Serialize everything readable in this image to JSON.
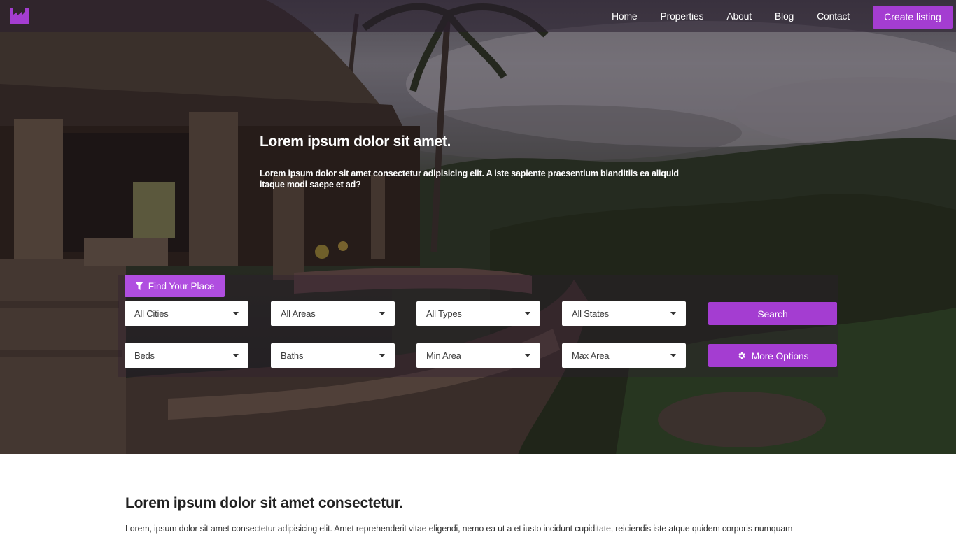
{
  "brand": {
    "accent": "#a43dd1",
    "logo_icon": "factory-icon"
  },
  "nav": {
    "links": [
      "Home",
      "Properties",
      "About",
      "Blog",
      "Contact"
    ],
    "cta": "Create listing"
  },
  "hero": {
    "title": "Lorem ipsum dolor sit amet.",
    "subtitle": "Lorem ipsum dolor sit amet consectetur adipisicing elit. A iste sapiente praesentium blanditiis ea aliquid itaque modi saepe et ad?"
  },
  "search": {
    "tab_label": "Find Your Place",
    "tab_icon": "filter-icon",
    "cities": "All Cities",
    "areas": "All Areas",
    "types": "All Types",
    "states": "All States",
    "beds": "Beds",
    "baths": "Baths",
    "min_area": "Min Area",
    "max_area": "Max Area",
    "search_button": "Search",
    "more_options_button": "More Options",
    "more_options_icon": "gear-icon"
  },
  "section": {
    "title": "Lorem ipsum dolor sit amet consectetur.",
    "text": "Lorem, ipsum dolor sit amet consectetur adipisicing elit. Amet reprehenderit vitae eligendi, nemo ea ut a et iusto incidunt cupiditate, reiciendis iste atque quidem corporis numquam"
  }
}
